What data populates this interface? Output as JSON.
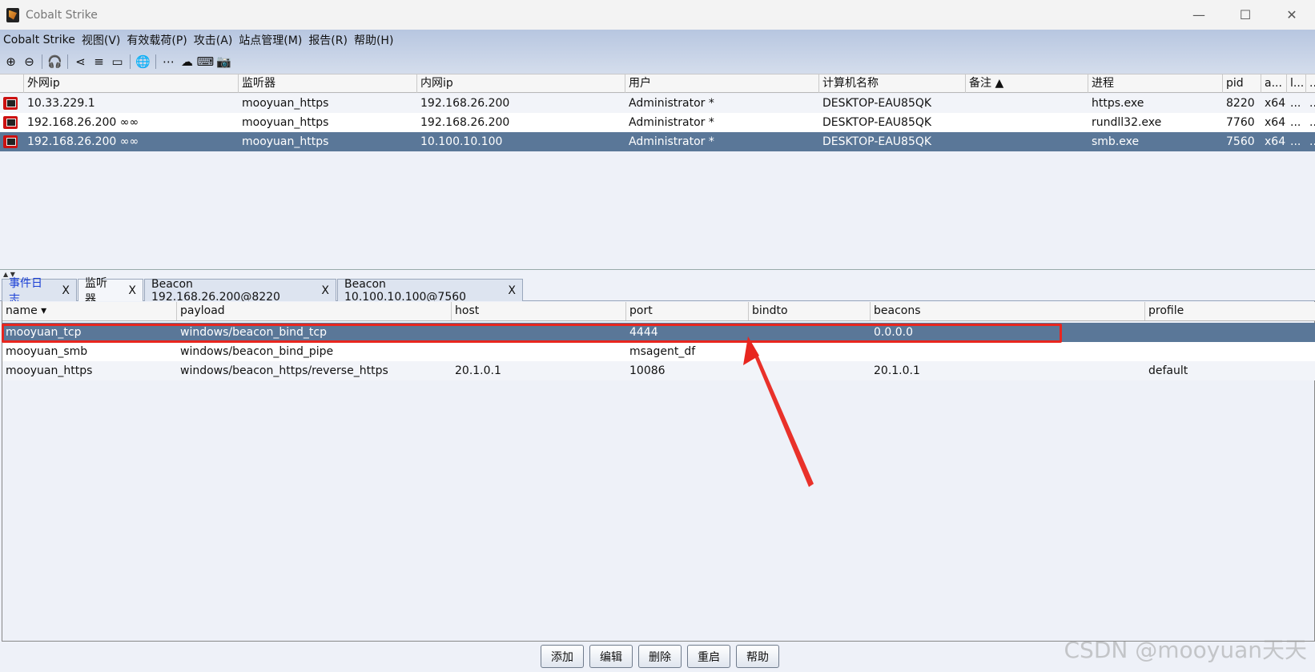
{
  "window": {
    "title": "Cobalt Strike",
    "controls": [
      "—",
      "☐",
      "✕"
    ]
  },
  "menu": [
    "Cobalt Strike",
    "视图(V)",
    "有效载荷(P)",
    "攻击(A)",
    "站点管理(M)",
    "报告(R)",
    "帮助(H)"
  ],
  "toolbar": {
    "icons": [
      "plus-circle-icon",
      "minus-circle-icon",
      "headphones-icon",
      "share-icon",
      "list-icon",
      "monitor-icon",
      "globe-icon",
      "dots-icon",
      "cloud-download-icon",
      "keyboard-icon",
      "camera-icon"
    ],
    "glyphs": [
      "⊕",
      "⊖",
      "🎧",
      "⋖",
      "≡",
      "▭",
      "🌐",
      "⋯",
      "☁",
      "⌨",
      "📷"
    ]
  },
  "beacons_table": {
    "columns": [
      "",
      "外网ip",
      "监听器",
      "内网ip",
      "用户",
      "计算机名称",
      "备注 ▲",
      "进程",
      "pid",
      "a...",
      "l...",
      "..."
    ],
    "rows": [
      [
        "",
        "10.33.229.1",
        "mooyuan_https",
        "192.168.26.200",
        "Administrator *",
        "DESKTOP-EAU85QK",
        "",
        "https.exe",
        "8220",
        "x64",
        "...",
        "..."
      ],
      [
        "",
        "192.168.26.200 ∞∞",
        "mooyuan_https",
        "192.168.26.200",
        "Administrator *",
        "DESKTOP-EAU85QK",
        "",
        "rundll32.exe",
        "7760",
        "x64",
        "...",
        "..."
      ],
      [
        "",
        "192.168.26.200 ∞∞",
        "mooyuan_https",
        "10.100.10.100",
        "Administrator *",
        "DESKTOP-EAU85QK",
        "",
        "smb.exe",
        "7560",
        "x64",
        "...",
        "..."
      ]
    ],
    "selected_row": 2
  },
  "tabs": [
    {
      "label": "事件日志",
      "close": "X"
    },
    {
      "label": "监听器",
      "close": "X"
    },
    {
      "label": "Beacon 192.168.26.200@8220",
      "close": "X"
    },
    {
      "label": "Beacon 10.100.10.100@7560",
      "close": "X"
    }
  ],
  "listeners_table": {
    "columns": [
      "name ▾",
      "payload",
      "host",
      "port",
      "bindto",
      "beacons",
      "profile"
    ],
    "rows": [
      [
        "mooyuan_tcp",
        "windows/beacon_bind_tcp",
        "",
        "4444",
        "",
        "0.0.0.0",
        ""
      ],
      [
        "mooyuan_smb",
        "windows/beacon_bind_pipe",
        "",
        "msagent_df",
        "",
        "",
        ""
      ],
      [
        "mooyuan_https",
        "windows/beacon_https/reverse_https",
        "20.1.0.1",
        "10086",
        "",
        "20.1.0.1",
        "default"
      ]
    ],
    "selected_row": 0
  },
  "buttons": [
    "添加",
    "编辑",
    "删除",
    "重启",
    "帮助"
  ],
  "watermark": "CSDN @mooyuan天天",
  "colors": {
    "selection": "#5a7798",
    "highlight": "#e8261f",
    "tab_blue": "#1a3fd6"
  }
}
